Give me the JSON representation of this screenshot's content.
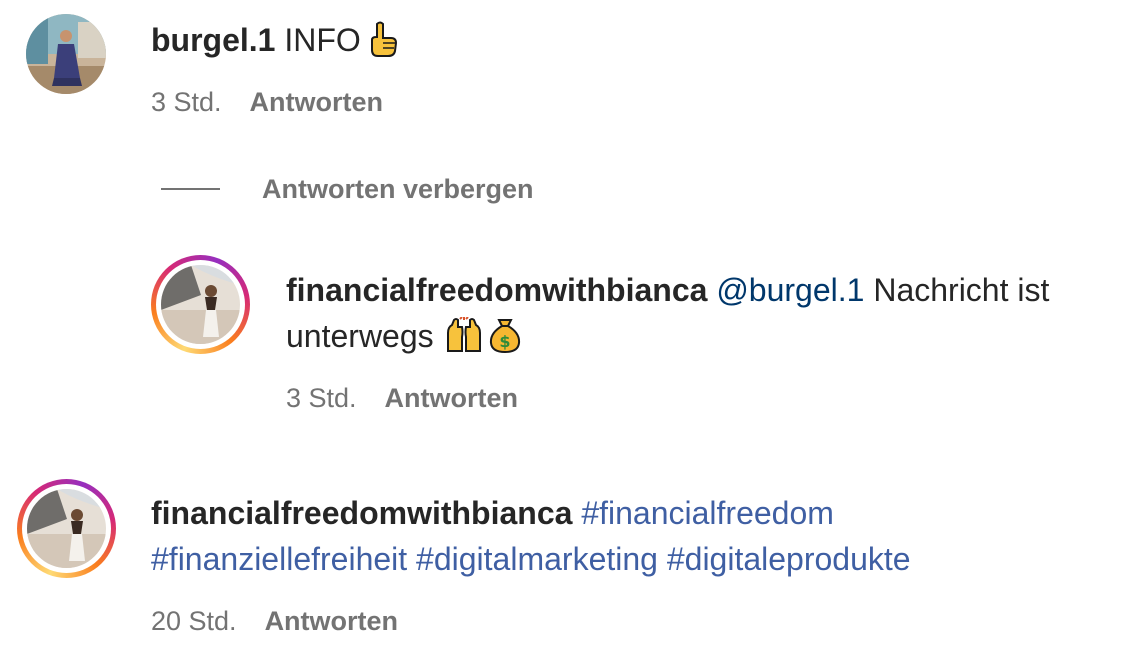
{
  "comments": [
    {
      "username": "burgel.1",
      "text": "INFO",
      "emoji_icons": [
        "pointing-up-icon"
      ],
      "time": "3 Std.",
      "reply_label": "Antworten"
    }
  ],
  "replies_toggle": {
    "label": "Antworten verbergen"
  },
  "reply": {
    "username": "financialfreedomwithbianca",
    "mention": "@burgel.1",
    "text_line1": "Nachricht ist",
    "text_line2": "unterwegs",
    "emoji_icons": [
      "raising-hands-icon",
      "money-bag-icon"
    ],
    "time": "3 Std.",
    "reply_label": "Antworten"
  },
  "comment2": {
    "username": "financialfreedomwithbianca",
    "hashtag1": "#financialfreedom",
    "hashtags_line2": "#finanziellefreiheit #digitalmarketing #digitaleprodukte",
    "time": "20 Std.",
    "reply_label": "Antworten"
  },
  "colors": {
    "username": "#262626",
    "meta": "#737373",
    "mention": "#00376b",
    "hashtag": "#3f5fa3",
    "story_ring": [
      "#feda75",
      "#fa7e1e",
      "#d62976",
      "#962fbf"
    ]
  }
}
